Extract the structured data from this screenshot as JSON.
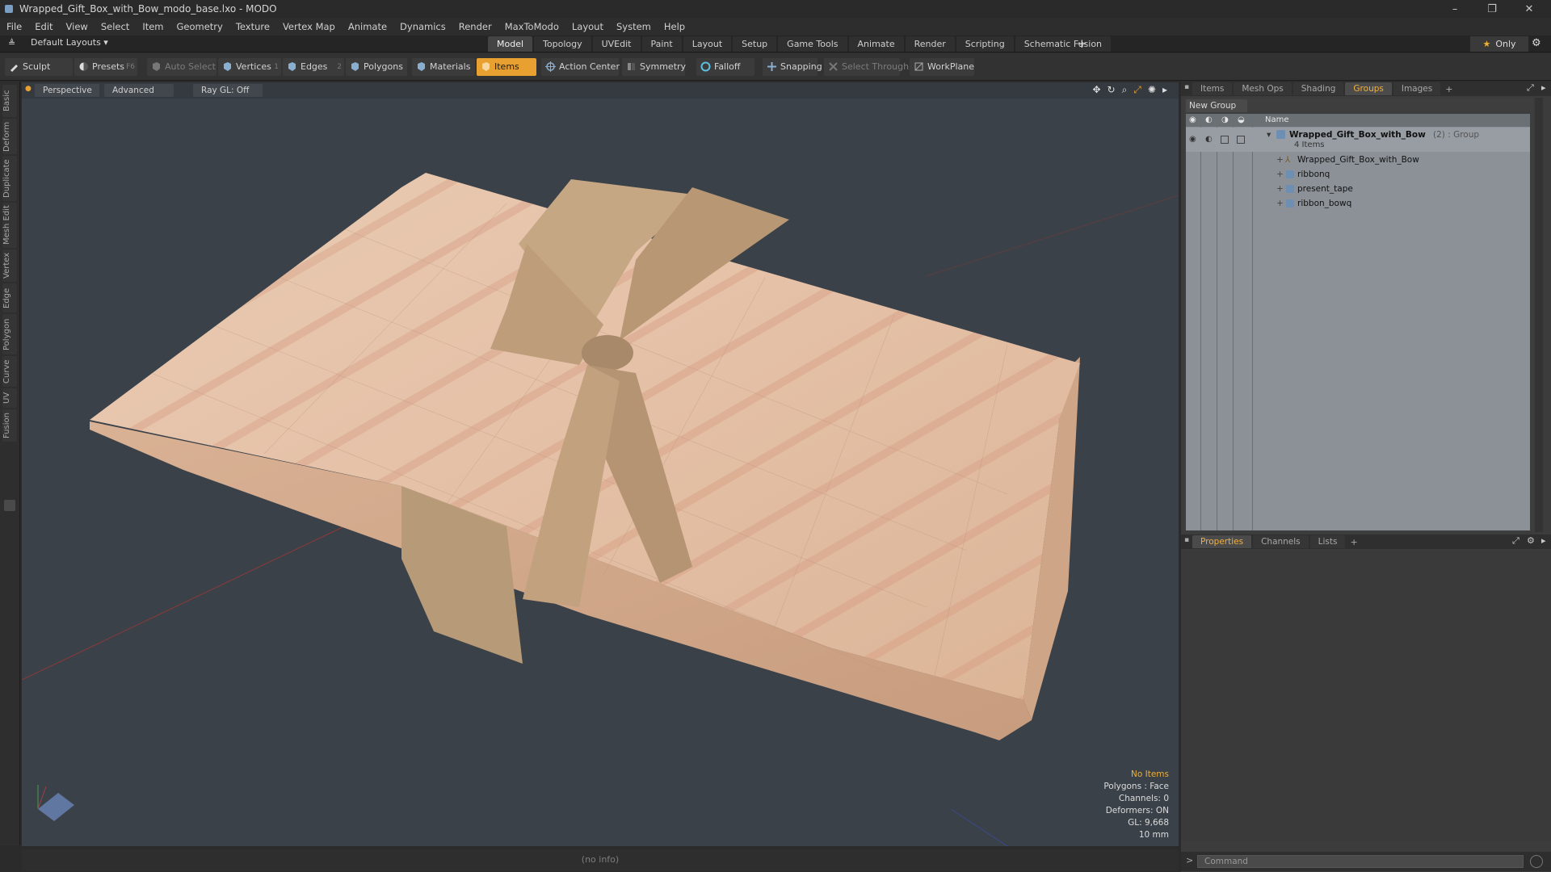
{
  "window": {
    "title": "Wrapped_Gift_Box_with_Bow_modo_base.lxo - MODO",
    "minimize": "–",
    "restore": "❐",
    "close": "✕"
  },
  "menu": [
    "File",
    "Edit",
    "View",
    "Select",
    "Item",
    "Geometry",
    "Texture",
    "Vertex Map",
    "Animate",
    "Dynamics",
    "Render",
    "MaxToModo",
    "Layout",
    "System",
    "Help"
  ],
  "layoutbar": {
    "layout_label": "Default Layouts ▾",
    "tabs": [
      "Model",
      "Topology",
      "UVEdit",
      "Paint",
      "Layout",
      "Setup",
      "Game Tools",
      "Animate",
      "Render",
      "Scripting",
      "Schematic Fusion"
    ],
    "active_tab": "Model",
    "plus": "+",
    "only_label": "Only",
    "gear": "⚙"
  },
  "toolbar": {
    "sculpt": "Sculpt",
    "presets": "Presets",
    "presets_key": "F6",
    "auto_select": "Auto Select",
    "vertices": "Vertices",
    "vertices_key": "1",
    "edges": "Edges",
    "edges_key": "2",
    "polygons": "Polygons",
    "materials": "Materials",
    "items": "Items",
    "action_center": "Action Center",
    "symmetry": "Symmetry",
    "falloff": "Falloff",
    "snapping": "Snapping",
    "select_through": "Select Through",
    "workplane": "WorkPlane"
  },
  "left_tabs": [
    "Basic",
    "Deform",
    "Duplicate",
    "Mesh Edit",
    "Vertex",
    "Edge",
    "Polygon",
    "Curve",
    "UV",
    "Fusion"
  ],
  "viewport": {
    "perspective": "Perspective",
    "advanced": "Advanced",
    "raygl": "Ray GL: Off",
    "stats": {
      "no_items": "No Items",
      "polygons": "Polygons : Face",
      "channels": "Channels: 0",
      "deformers": "Deformers: ON",
      "gl": "GL: 9,668",
      "scale": "10 mm"
    }
  },
  "infobar": "(no info)",
  "right_panel": {
    "tabs": [
      "Items",
      "Mesh Ops",
      "Shading",
      "Groups",
      "Images"
    ],
    "active_tab": "Groups",
    "plus": "+",
    "new_group": "New Group",
    "name_header": "Name",
    "group_name": "Wrapped_Gift_Box_with_Bow",
    "group_suffix": "(2) : Group",
    "group_count": "4 Items",
    "children": [
      "Wrapped_Gift_Box_with_Bow",
      "ribbonq",
      "present_tape",
      "ribbon_bowq"
    ],
    "props_tabs": [
      "Properties",
      "Channels",
      "Lists"
    ],
    "props_active": "Properties",
    "command_placeholder": "Command"
  },
  "colors": {
    "accent": "#e8a030",
    "paper": "#e6c2a8",
    "ribbon": "#bfa27c",
    "viewport_bg": "#3b4148"
  }
}
